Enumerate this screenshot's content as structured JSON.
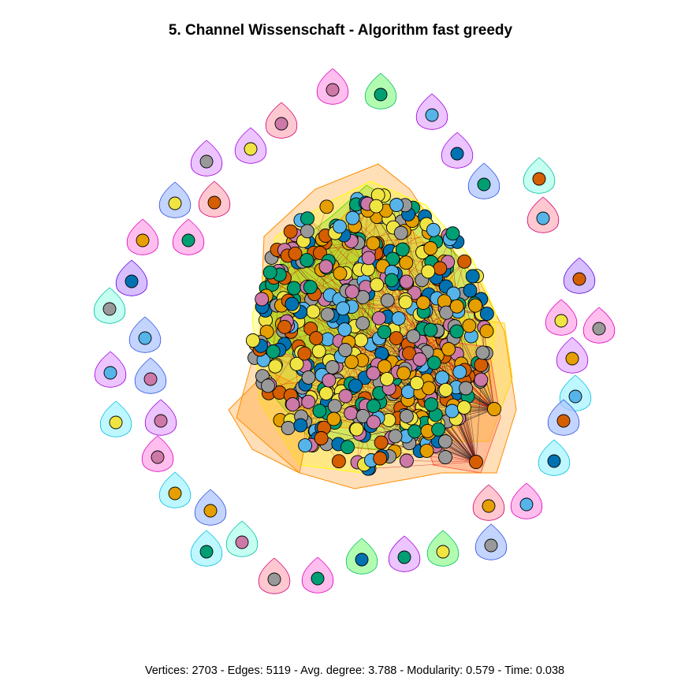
{
  "title": "5. Channel Wissenschaft - Algorithm fast greedy",
  "stats": "Vertices: 2703 - Edges: 5119 - Avg. degree: 3.788 - Modularity: 0.579 - Time: 0.038",
  "palette": {
    "node_colors": [
      "#E69F00",
      "#56B4E9",
      "#009E73",
      "#F0E442",
      "#0072B2",
      "#D55E00",
      "#CC79A7",
      "#999999"
    ],
    "hull_colors": [
      "#FFFF00",
      "#FF8C00",
      "#66DD00",
      "#FFA500",
      "#FFD700",
      "#FF6347"
    ],
    "isolated_fill_colors": [
      "#FFB6C1",
      "#98FB98",
      "#E6B0FF",
      "#AFC6FF",
      "#B0FFEE",
      "#A8F4FF",
      "#FFA8E8",
      "#C8A8FF"
    ],
    "isolated_stroke_colors": [
      "#D0006F",
      "#00C060",
      "#A000E0",
      "#3050E0",
      "#00C0A0",
      "#00C0E0",
      "#E000C0",
      "#6000E0"
    ]
  }
}
